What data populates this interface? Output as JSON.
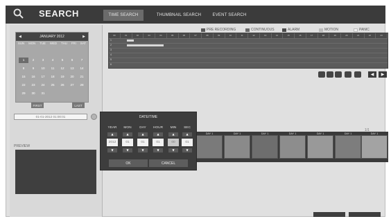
{
  "header": {
    "title": "SEARCH",
    "tabs": [
      {
        "label": "TIME SEARCH",
        "active": true
      },
      {
        "label": "THUMBNAIL SEARCH",
        "active": false
      },
      {
        "label": "EVENT SEARCH",
        "active": false
      }
    ]
  },
  "calendar": {
    "month_label": "JANUARY 2012",
    "days_of_week": [
      "SUN",
      "MON",
      "TUE",
      "WED",
      "THU",
      "FRI",
      "SAT"
    ],
    "days": [
      "",
      "",
      "",
      "",
      "",
      "",
      "",
      "1",
      "2",
      "3",
      "4",
      "5",
      "6",
      "7",
      "8",
      "9",
      "10",
      "11",
      "12",
      "13",
      "14",
      "15",
      "16",
      "17",
      "18",
      "19",
      "20",
      "21",
      "22",
      "23",
      "24",
      "25",
      "26",
      "27",
      "28",
      "29",
      "30",
      "31"
    ],
    "selected_day": "1",
    "first_label": "FIRST",
    "last_label": "LAST"
  },
  "datetime_field": {
    "value": "01-01-2012 01:00:01"
  },
  "preview": {
    "label": "PREVIEW"
  },
  "legend": [
    {
      "label": "PRE RECORDING",
      "color": "#585858"
    },
    {
      "label": "CONTINUOUS",
      "color": "#6a6a6a"
    },
    {
      "label": "ALARM",
      "color": "#4a4a4a"
    },
    {
      "label": "MOTION",
      "color": "#bcbcbc"
    },
    {
      "label": "PANIC",
      "color": "#f0f0f0"
    }
  ],
  "timeline": {
    "hours": [
      "00",
      "01",
      "02",
      "03",
      "04",
      "05",
      "06",
      "07",
      "08",
      "09",
      "10",
      "11",
      "12",
      "13",
      "14",
      "15",
      "16",
      "17",
      "18",
      "19",
      "20",
      "21",
      "22",
      "23"
    ],
    "channels": [
      "1",
      "2",
      "3",
      "4",
      "5",
      "6"
    ],
    "bars": [
      {
        "channel": "1",
        "start_hour": 1.0,
        "end_hour": 1.6
      },
      {
        "channel": "2",
        "start_hour": 1.0,
        "end_hour": 4.2
      }
    ]
  },
  "thumbnails": {
    "count_label": "1/1",
    "items": [
      {
        "label": "DAY 1"
      },
      {
        "label": "DAY 1"
      },
      {
        "label": "DAY 1"
      },
      {
        "label": "DAY 1"
      },
      {
        "label": "DAY 1"
      },
      {
        "label": "DAY 1"
      },
      {
        "label": "DAY 1"
      }
    ]
  },
  "popup": {
    "title": "DATE/TIME",
    "fields": [
      {
        "label": "YEAR",
        "value": "2012"
      },
      {
        "label": "MON",
        "value": "01"
      },
      {
        "label": "DAY",
        "value": "01"
      },
      {
        "label": "HOUR",
        "value": "01"
      },
      {
        "label": "MIN",
        "value": "00"
      },
      {
        "label": "SEC",
        "value": "01"
      }
    ],
    "up_arrow": "▲",
    "down_arrow": "▼",
    "ok_label": "OK",
    "cancel_label": "CANCEL"
  },
  "controls": {
    "prev_arrow": "◀",
    "next_arrow": "▶"
  },
  "colors": {
    "titlebar": "#3b3b3b",
    "panel": "#d9d9d9",
    "popup": "#3d3d3d"
  }
}
